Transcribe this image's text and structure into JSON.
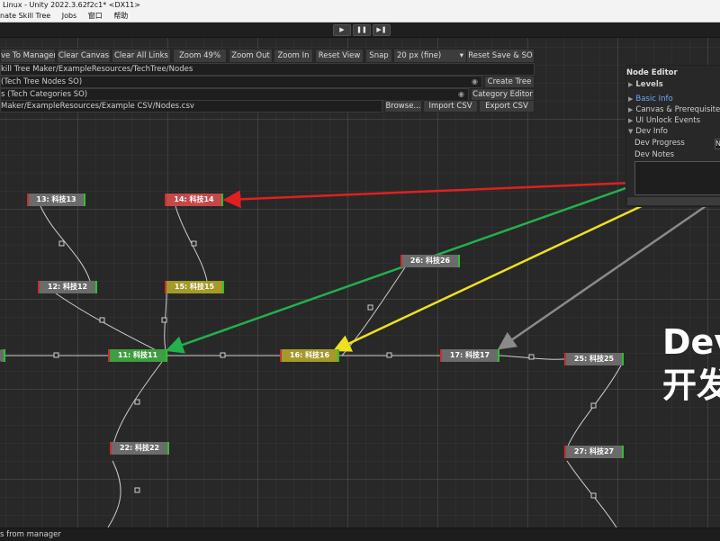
{
  "window": {
    "title": "Linux - Unity 2022.3.62f2c1* <DX11>"
  },
  "menu": {
    "items": [
      "nate Skill Tree",
      "Jobs",
      "窗口",
      "帮助"
    ]
  },
  "playbar": {
    "play": "▶",
    "pause": "❚❚",
    "step": "▶❚"
  },
  "toolbar": {
    "save_to_manager": "ve To Manager",
    "clear_canvas": "Clear Canvas",
    "clear_all_links": "Clear All Links",
    "zoom": "Zoom 49%",
    "zoom_out": "Zoom Out",
    "zoom_in": "Zoom In",
    "reset_view": "Reset View",
    "snap": "Snap",
    "snap_value": "20 px (fine)",
    "reset_save": "Reset Save & SO"
  },
  "fields": {
    "tree_path": "kill Tree Maker/ExampleResources/TechTree/Nodes",
    "nodes_so": "(Tech Tree Nodes SO)",
    "create_tree": "Create Tree",
    "categories_so": "s (Tech Categories SO)",
    "category_editor": "Category Editor",
    "csv_path": "Maker/ExampleResources/Example CSV/Nodes.csv",
    "browse": "Browse...",
    "import_csv": "Import CSV",
    "export_csv": "Export CSV"
  },
  "nodes": [
    {
      "label": "13: 科技13",
      "color": "#6b6b6b"
    },
    {
      "label": "14: 科技14",
      "color": "#c64848"
    },
    {
      "label": "26: 科技26",
      "color": "#6b6b6b"
    },
    {
      "label": "12: 科技12",
      "color": "#6b6b6b"
    },
    {
      "label": "15: 科技15",
      "color": "#a39a2a"
    },
    {
      "label": "11: 科技11",
      "color": "#3f9e3f"
    },
    {
      "label": "16: 科技16",
      "color": "#a39a2a"
    },
    {
      "label": "17: 科技17",
      "color": "#6b6b6b"
    },
    {
      "label": "25: 科技25",
      "color": "#6b6b6b"
    },
    {
      "label": "22: 科技22",
      "color": "#6b6b6b"
    },
    {
      "label": "27: 科技27",
      "color": "#6b6b6b"
    }
  ],
  "editor": {
    "title": "Node Editor",
    "levels": "Levels",
    "basic_info": "Basic Info",
    "canvas_prereq": "Canvas & Prerequisites",
    "ui_unlock": "UI Unlock Events",
    "dev_info": "Dev Info",
    "dev_progress": "Dev Progress",
    "dev_notes": "Dev Notes",
    "progress_value": "N"
  },
  "overlay": {
    "line1": "Dev",
    "line2": "开发"
  },
  "status": {
    "text": "s from manager"
  },
  "colors": {
    "green_arrow": "#22b14c",
    "red_arrow": "#e02020",
    "yellow_arrow": "#f0e020",
    "gray_arrow": "#8a8a8a",
    "accent": "#6fa8ff"
  }
}
